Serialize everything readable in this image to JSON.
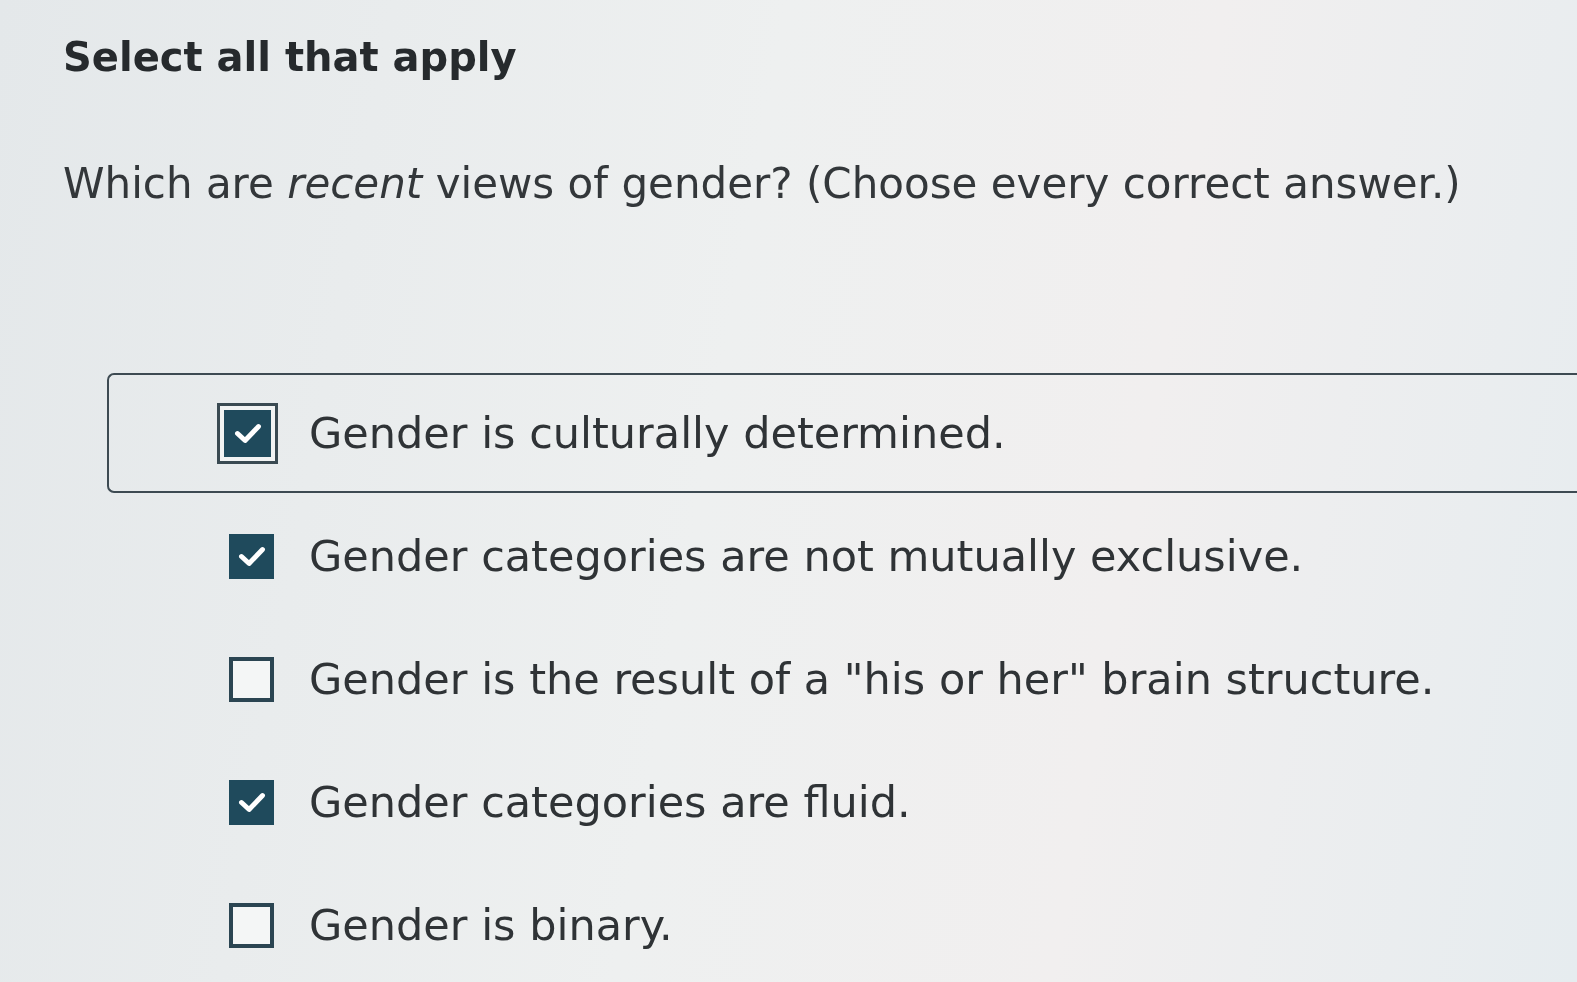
{
  "heading": "Select all that apply",
  "question": "Which are *recent* views of gender? (Choose every correct answer.)",
  "options": [
    {
      "label": "Gender is culturally determined.",
      "checked": true,
      "focused": true
    },
    {
      "label": "Gender categories are not mutually exclusive.",
      "checked": true,
      "focused": false
    },
    {
      "label": "Gender is the result of a \"his or her\" brain structure.",
      "checked": false,
      "focused": false
    },
    {
      "label": "Gender categories are fluid.",
      "checked": true,
      "focused": false
    },
    {
      "label": "Gender is binary.",
      "checked": false,
      "focused": false
    }
  ]
}
